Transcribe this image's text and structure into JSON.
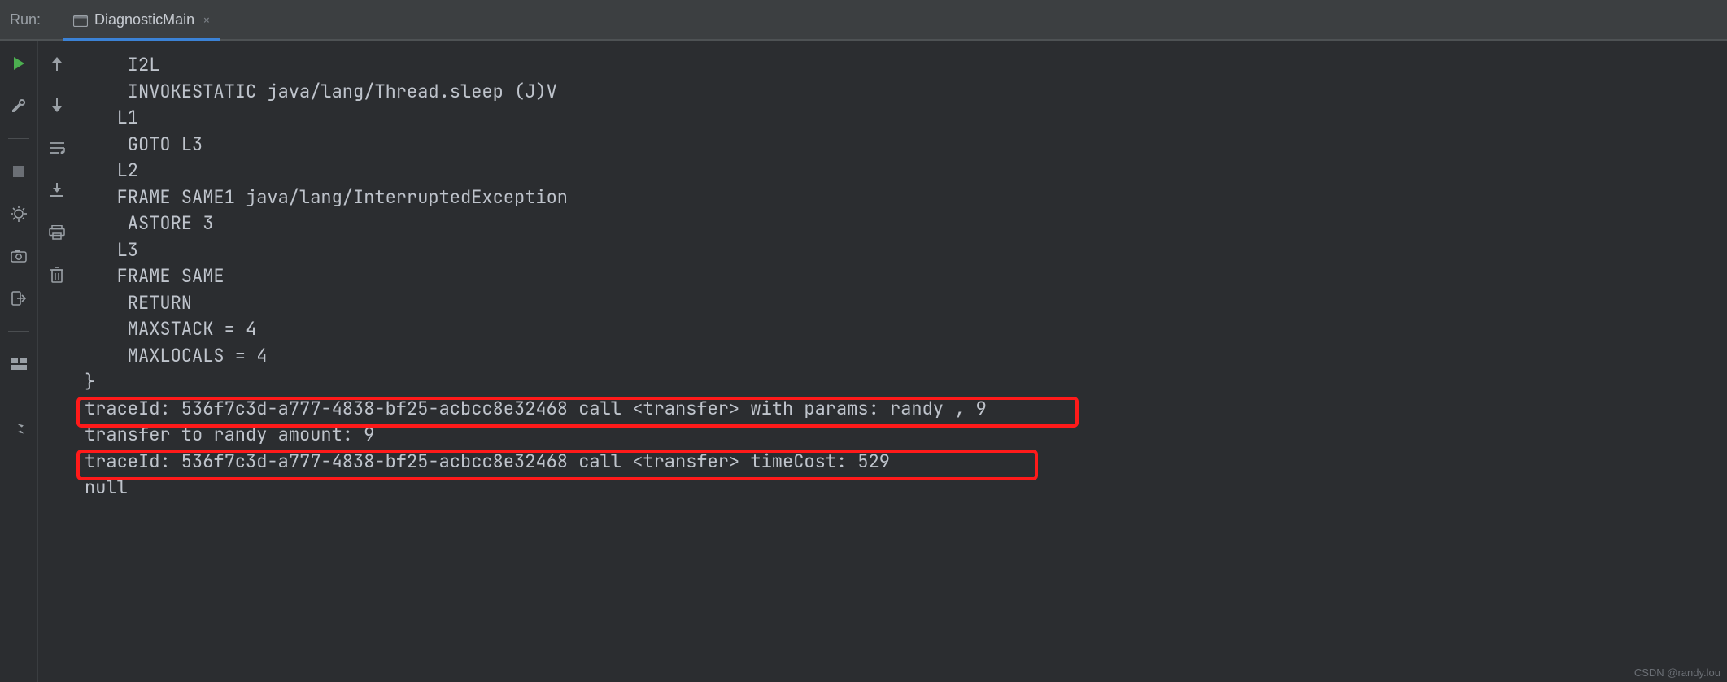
{
  "header": {
    "run_label": "Run:",
    "tab": {
      "label": "DiagnosticMain",
      "close": "×"
    }
  },
  "console": {
    "lines": [
      "    I2L",
      "    INVOKESTATIC java/lang/Thread.sleep (J)V",
      "   L1",
      "    GOTO L3",
      "   L2",
      "   FRAME SAME1 java/lang/InterruptedException",
      "    ASTORE 3",
      "   L3",
      "   FRAME SAME",
      "    RETURN",
      "    MAXSTACK = 4",
      "    MAXLOCALS = 4",
      "}",
      "traceId: 536f7c3d-a777-4838-bf25-acbcc8e32468 call <transfer> with params: randy , 9",
      "transfer to randy amount: 9",
      "traceId: 536f7c3d-a777-4838-bf25-acbcc8e32468 call <transfer> timeCost: 529",
      "null"
    ]
  },
  "watermark": "CSDN @randy.lou"
}
